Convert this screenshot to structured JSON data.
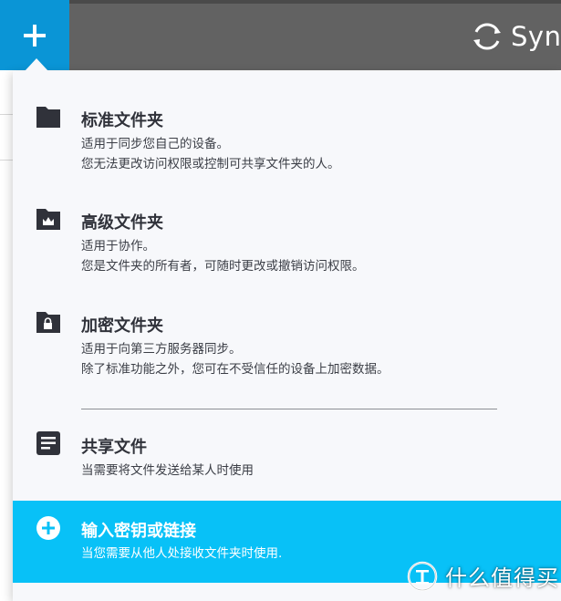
{
  "header": {
    "brand_text": "Sync",
    "add_button_icon": "plus-icon",
    "brand_icon": "sync-logo-icon",
    "colors": {
      "bar": "#626262",
      "add_button": "#0a95d6"
    }
  },
  "menu": {
    "items": [
      {
        "icon": "folder-icon",
        "title": "标准文件夹",
        "desc1": "适用于同步您自己的设备。",
        "desc2": "您无法更改访问权限或控制可共享文件夹的人。"
      },
      {
        "icon": "folder-crown-icon",
        "title": "高级文件夹",
        "desc1": "适用于协作。",
        "desc2": "您是文件夹的所有者，可随时更改或撤销访问权限。"
      },
      {
        "icon": "folder-lock-icon",
        "title": "加密文件夹",
        "desc1": "适用于向第三方服务器同步。",
        "desc2": "除了标准功能之外，您可在不受信任的设备上加密数据。"
      },
      {
        "icon": "file-document-icon",
        "title": "共享文件",
        "desc1": "当需要将文件发送给某人时使用"
      }
    ],
    "highlight": {
      "icon": "plus-circle-icon",
      "title": "输入密钥或链接",
      "desc1": "当您需要从他人处接收文件夹时使用.",
      "color": "#08c1f7"
    }
  },
  "watermark": {
    "text": "什么值得买",
    "icon": "zhi-logo-icon"
  }
}
